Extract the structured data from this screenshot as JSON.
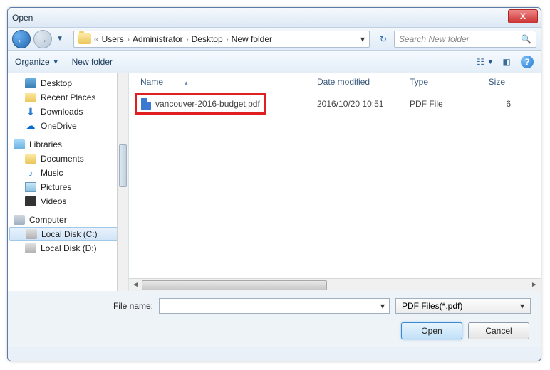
{
  "window": {
    "title": "Open"
  },
  "breadcrumb": {
    "items": [
      "Users",
      "Administrator",
      "Desktop",
      "New folder"
    ]
  },
  "search": {
    "placeholder": "Search New folder"
  },
  "toolbar": {
    "organize": "Organize",
    "newfolder": "New folder"
  },
  "sidebar": {
    "desktop": "Desktop",
    "recent": "Recent Places",
    "downloads": "Downloads",
    "onedrive": "OneDrive",
    "libraries": "Libraries",
    "documents": "Documents",
    "music": "Music",
    "pictures": "Pictures",
    "videos": "Videos",
    "computer": "Computer",
    "diskc": "Local Disk (C:)",
    "diskd": "Local Disk (D:)"
  },
  "columns": {
    "name": "Name",
    "date": "Date modified",
    "type": "Type",
    "size": "Size"
  },
  "files": [
    {
      "name": "vancouver-2016-budget.pdf",
      "date": "2016/10/20 10:51",
      "type": "PDF File",
      "size": "6"
    }
  ],
  "filename": {
    "label": "File name:",
    "value": ""
  },
  "filter": {
    "label": "PDF Files(*.pdf)"
  },
  "buttons": {
    "open": "Open",
    "cancel": "Cancel"
  }
}
